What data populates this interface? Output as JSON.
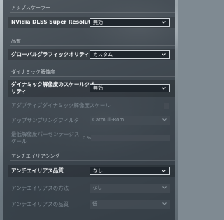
{
  "upscaler": {
    "section_title": "アップスケーラー",
    "dlss_label": "NVidia DLSS Super Resolution",
    "dlss_value": "無効"
  },
  "quality": {
    "section_title": "品質",
    "global_quality_label": "グローバルグラフィックオリティ",
    "global_quality_value": "カスタム"
  },
  "dynamic_resolution": {
    "section_title": "ダイナミック解像度",
    "scale_quality_label_line1": "ダイナミック解像度のスケールクオ",
    "scale_quality_label_line2": "リティ",
    "scale_quality_value": "無効",
    "adaptive_label": "アダプティブダイナミック解像度スケール",
    "upsampling_filter_label": "アップサンプリングフィルタ",
    "upsampling_filter_value": "Catmull-Rom",
    "min_res_label_line1": "最低解像度パーセンテージス",
    "min_res_label_line2": "ケール",
    "min_res_value": "0 %"
  },
  "antialiasing": {
    "section_title": "アンチエイリアシング",
    "aa_quality_label": "アンチエイリアス品質",
    "aa_quality_value": "なし",
    "aa_method_label": "アンチエイリアスの方法",
    "aa_method_value": "なし",
    "aa_quality2_label": "アンチエイリアスの品質",
    "aa_quality2_value": "低"
  },
  "colors": {
    "panel_bg": "#283038",
    "active_text": "#f2f4f6",
    "disabled_text": "#7f8a93",
    "dropdown_border": "#cfd5da"
  }
}
